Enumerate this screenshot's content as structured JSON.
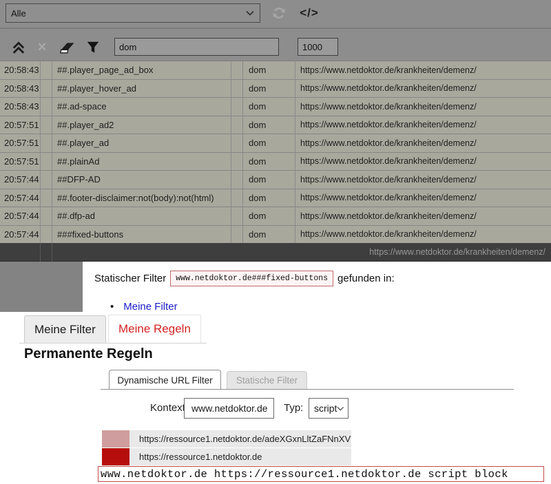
{
  "colors": {
    "link_blue": "#1a1acc",
    "active_tab_red": "#d42222",
    "code_box_border": "#c06a6a",
    "editor_border": "#c34a4a",
    "rule_noop_color": "#cf9d9e",
    "rule_block_color": "#b60d0d"
  },
  "logger": {
    "filter_select_value": "Alle",
    "code_icon_label": "</>",
    "clear_icon_glyph": "✕",
    "search_value": "dom",
    "max_entries_value": "1000",
    "rows": [
      {
        "time": "20:58:43",
        "filter": "##.player_page_ad_box",
        "type": "dom",
        "url": "https://www.netdoktor.de/krankheiten/demenz/"
      },
      {
        "time": "20:58:43",
        "filter": "##.player_hover_ad",
        "type": "dom",
        "url": "https://www.netdoktor.de/krankheiten/demenz/"
      },
      {
        "time": "20:58:43",
        "filter": "##.ad-space",
        "type": "dom",
        "url": "https://www.netdoktor.de/krankheiten/demenz/"
      },
      {
        "time": "20:57:51",
        "filter": "##.player_ad2",
        "type": "dom",
        "url": "https://www.netdoktor.de/krankheiten/demenz/"
      },
      {
        "time": "20:57:51",
        "filter": "##.player_ad",
        "type": "dom",
        "url": "https://www.netdoktor.de/krankheiten/demenz/"
      },
      {
        "time": "20:57:51",
        "filter": "##.plainAd",
        "type": "dom",
        "url": "https://www.netdoktor.de/krankheiten/demenz/"
      },
      {
        "time": "20:57:44",
        "filter": "##DFP-AD",
        "type": "dom",
        "url": "https://www.netdoktor.de/krankheiten/demenz/"
      },
      {
        "time": "20:57:44",
        "filter": "##.footer-disclaimer:not(body):not(html)",
        "type": "dom",
        "url": "https://www.netdoktor.de/krankheiten/demenz/"
      },
      {
        "time": "20:57:44",
        "filter": "##.dfp-ad",
        "type": "dom",
        "url": "https://www.netdoktor.de/krankheiten/demenz/"
      },
      {
        "time": "20:57:44",
        "filter": "###fixed-buttons",
        "type": "dom",
        "url": "https://www.netdoktor.de/krankheiten/demenz/"
      }
    ],
    "footer_url": "https://www.netdoktor.de/krankheiten/demenz/"
  },
  "dialog": {
    "prefix": "Statischer Filter",
    "filter": "www.netdoktor.de###fixed-buttons",
    "suffix": "gefunden in:",
    "bullet": "•",
    "link": "Meine Filter"
  },
  "panel": {
    "tab_filters": "Meine Filter",
    "tab_rules": "Meine Regeln",
    "heading": "Permanente Regeln",
    "subtab_dynamic": "Dynamische URL Filter",
    "subtab_static": "Statische Filter",
    "context_label": "Kontext:",
    "context_value": "www.netdoktor.de",
    "type_label": "Typ:",
    "type_value": "script",
    "rules": [
      {
        "url": "https://ressource1.netdoktor.de/adeXGxnLltZaFNnXV"
      },
      {
        "url": "https://ressource1.netdoktor.de"
      }
    ],
    "editor_text": "www.netdoktor.de https://ressource1.netdoktor.de script block"
  }
}
